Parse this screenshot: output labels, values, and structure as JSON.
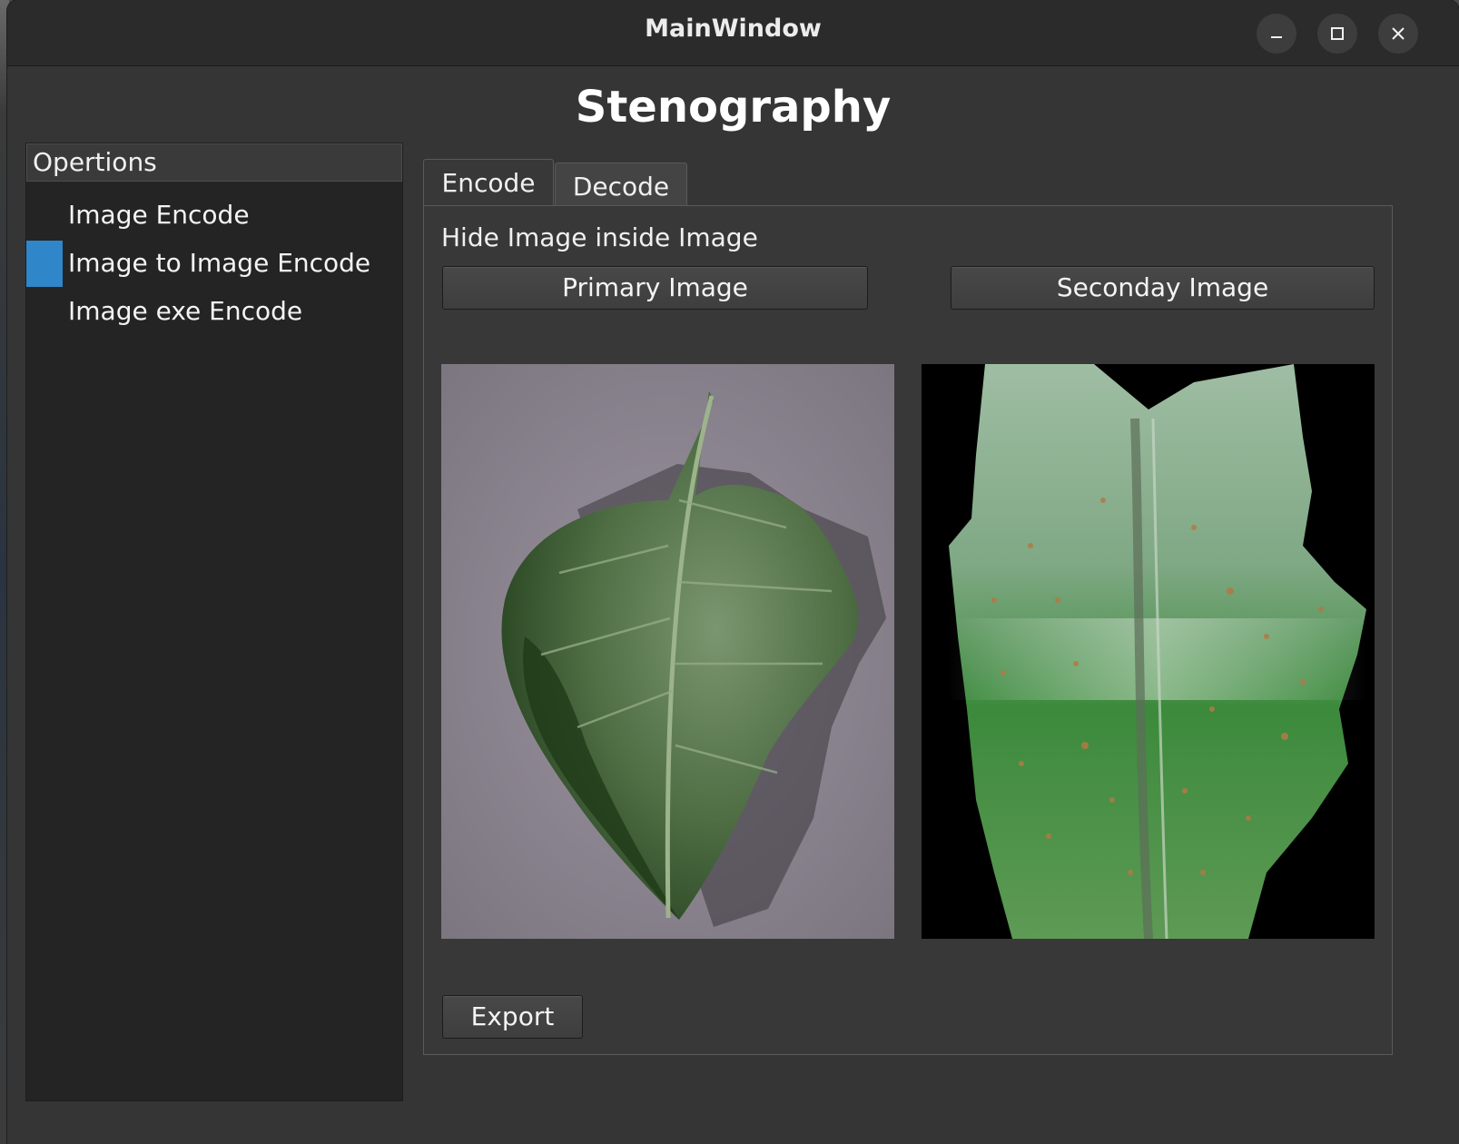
{
  "window": {
    "title": "MainWindow",
    "controls": {
      "minimize_icon": "minimize-icon",
      "maximize_icon": "maximize-icon",
      "close_icon": "close-icon"
    }
  },
  "header": {
    "heading": "Stenography"
  },
  "sidebar": {
    "header": "Opertions",
    "items": [
      {
        "label": "Image Encode",
        "selected": false
      },
      {
        "label": "Image to Image Encode",
        "selected": true
      },
      {
        "label": "Image exe Encode",
        "selected": false
      }
    ],
    "selection_color": "#2f86c8"
  },
  "tabs": [
    {
      "label": "Encode",
      "active": true
    },
    {
      "label": "Decode",
      "active": false
    }
  ],
  "encode_pane": {
    "description": "Hide Image inside Image",
    "primary_button": "Primary Image",
    "secondary_button": "Seconday Image",
    "primary_preview": "leaf-image",
    "secondary_preview": "leaf-image",
    "export_button": "Export"
  }
}
